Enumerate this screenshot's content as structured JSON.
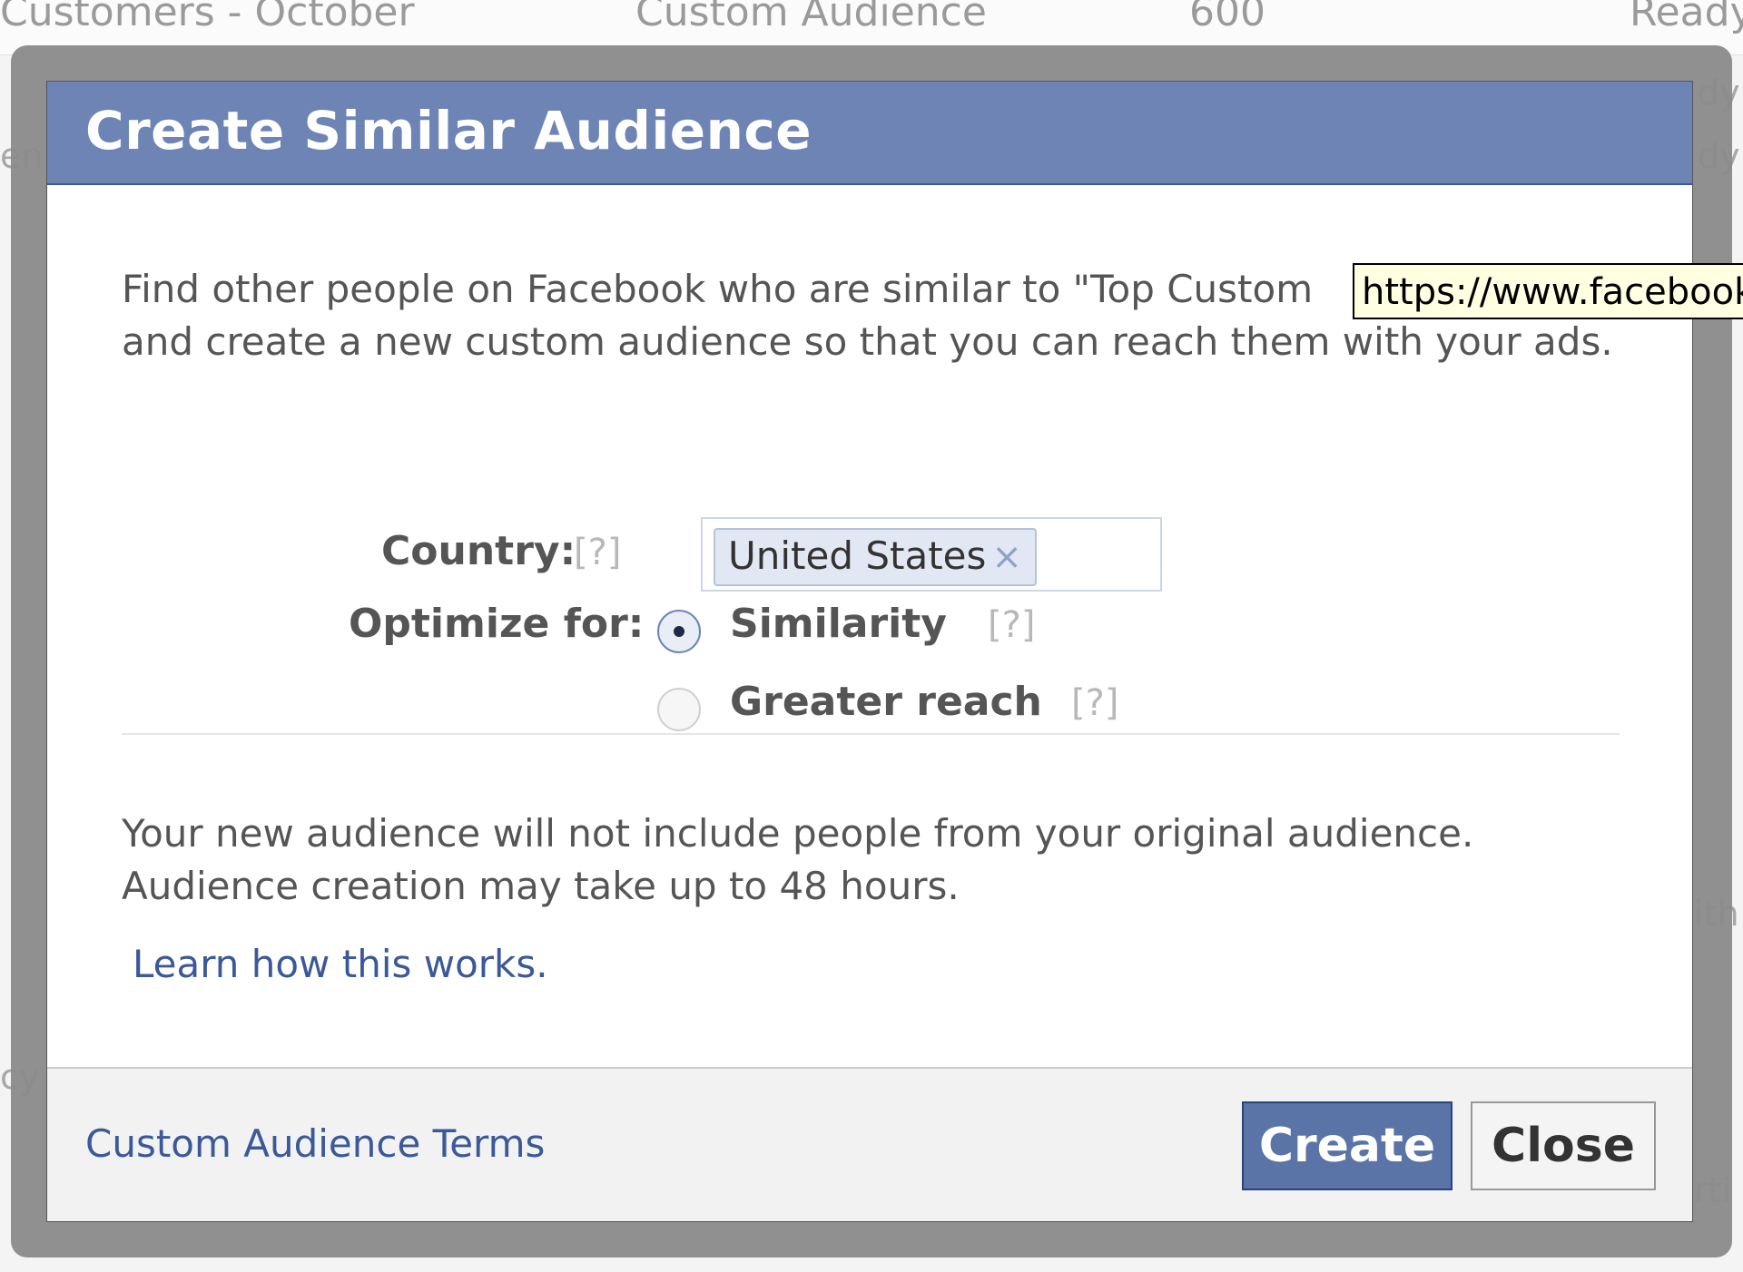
{
  "background": {
    "row1": {
      "name": "Customers - October",
      "type": "Custom Audience",
      "size": "600",
      "status": "Ready"
    },
    "right_fragments": [
      "dy",
      "dy",
      "ith",
      "rti"
    ],
    "left_fragments": [
      "en",
      "cy"
    ]
  },
  "dialog": {
    "title": "Create Similar Audience",
    "intro": "Find other people on Facebook who are similar to \"Top Custom",
    "intro_line2": "and create a new custom audience so that you can reach them with your ads.",
    "tooltip": "https://www.facebook",
    "country_label": "Country:",
    "help_mark": "[?]",
    "country_token": "United States",
    "token_remove": "×",
    "optimize_label": "Optimize for:",
    "options": [
      {
        "label": "Similarity",
        "selected": true
      },
      {
        "label": "Greater reach",
        "selected": false
      }
    ],
    "note_line1": "Your new audience will not include people from your original audience.",
    "note_line2": "Audience creation may take up to 48 hours.",
    "learn_link": "Learn how this works.",
    "terms_link": "Custom Audience Terms",
    "create_button": "Create",
    "close_button": "Close"
  },
  "colors": {
    "header": "#6d84b4",
    "primary_button": "#5b74a8",
    "link": "#3b5998"
  }
}
